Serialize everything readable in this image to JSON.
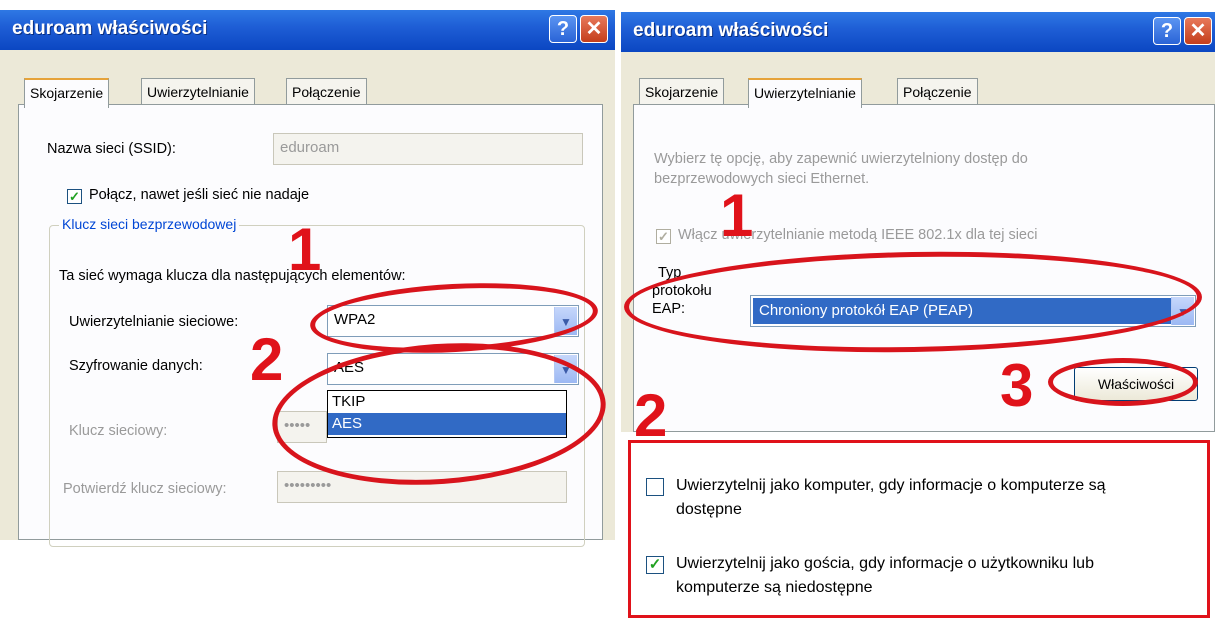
{
  "left_window": {
    "title": "eduroam właściwości",
    "tabs": [
      "Skojarzenie",
      "Uwierzytelnianie",
      "Połączenie"
    ],
    "ssid_label": "Nazwa sieci (SSID):",
    "ssid_value": "eduroam",
    "connect_checkbox_label": "Połącz, nawet jeśli sieć nie nadaje",
    "group_title": "Klucz sieci bezprzewodowej",
    "group_desc": "Ta sieć wymaga klucza dla następujących elementów:",
    "auth_label": "Uwierzytelnianie sieciowe:",
    "auth_value": "WPA2",
    "enc_label": "Szyfrowanie danych:",
    "enc_value": "AES",
    "enc_options": [
      "TKIP",
      "AES"
    ],
    "key_label": "Klucz sieciowy:",
    "key_value": "•••••",
    "confirm_label": "Potwierdź klucz sieciowy:",
    "confirm_value": "•••••••••"
  },
  "right_window": {
    "title": "eduroam właściwości",
    "tabs": [
      "Skojarzenie",
      "Uwierzytelnianie",
      "Połączenie"
    ],
    "desc_line1": "Wybierz tę opcję, aby zapewnić uwierzytelniony dostęp do",
    "desc_line2": "bezprzewodowych sieci Ethernet.",
    "ieee_checkbox_label": "Włącz uwierzytelnianie metodą IEEE 802.1x dla tej sieci",
    "eap_label_line1": "Typ",
    "eap_label_line2": "protokołu",
    "eap_label_line3": "EAP:",
    "eap_value": "Chroniony protokół EAP (PEAP)",
    "properties_button": "Właściwości"
  },
  "bottom_box": {
    "option1_line1": "Uwierzytelnij jako komputer, gdy informacje o komputerze są",
    "option1_line2": "dostępne",
    "option2_line1": "Uwierzytelnij jako gościa, gdy informacje o użytkowniku lub",
    "option2_line2": "komputerze są niedostępne"
  },
  "annotations": {
    "left_1": "1",
    "left_2": "2",
    "right_1": "1",
    "right_2": "2",
    "right_3": "3"
  },
  "colors": {
    "annotation_red": "#d8141c",
    "xp_blue": "#0b47c2",
    "selection": "#316ac5"
  }
}
